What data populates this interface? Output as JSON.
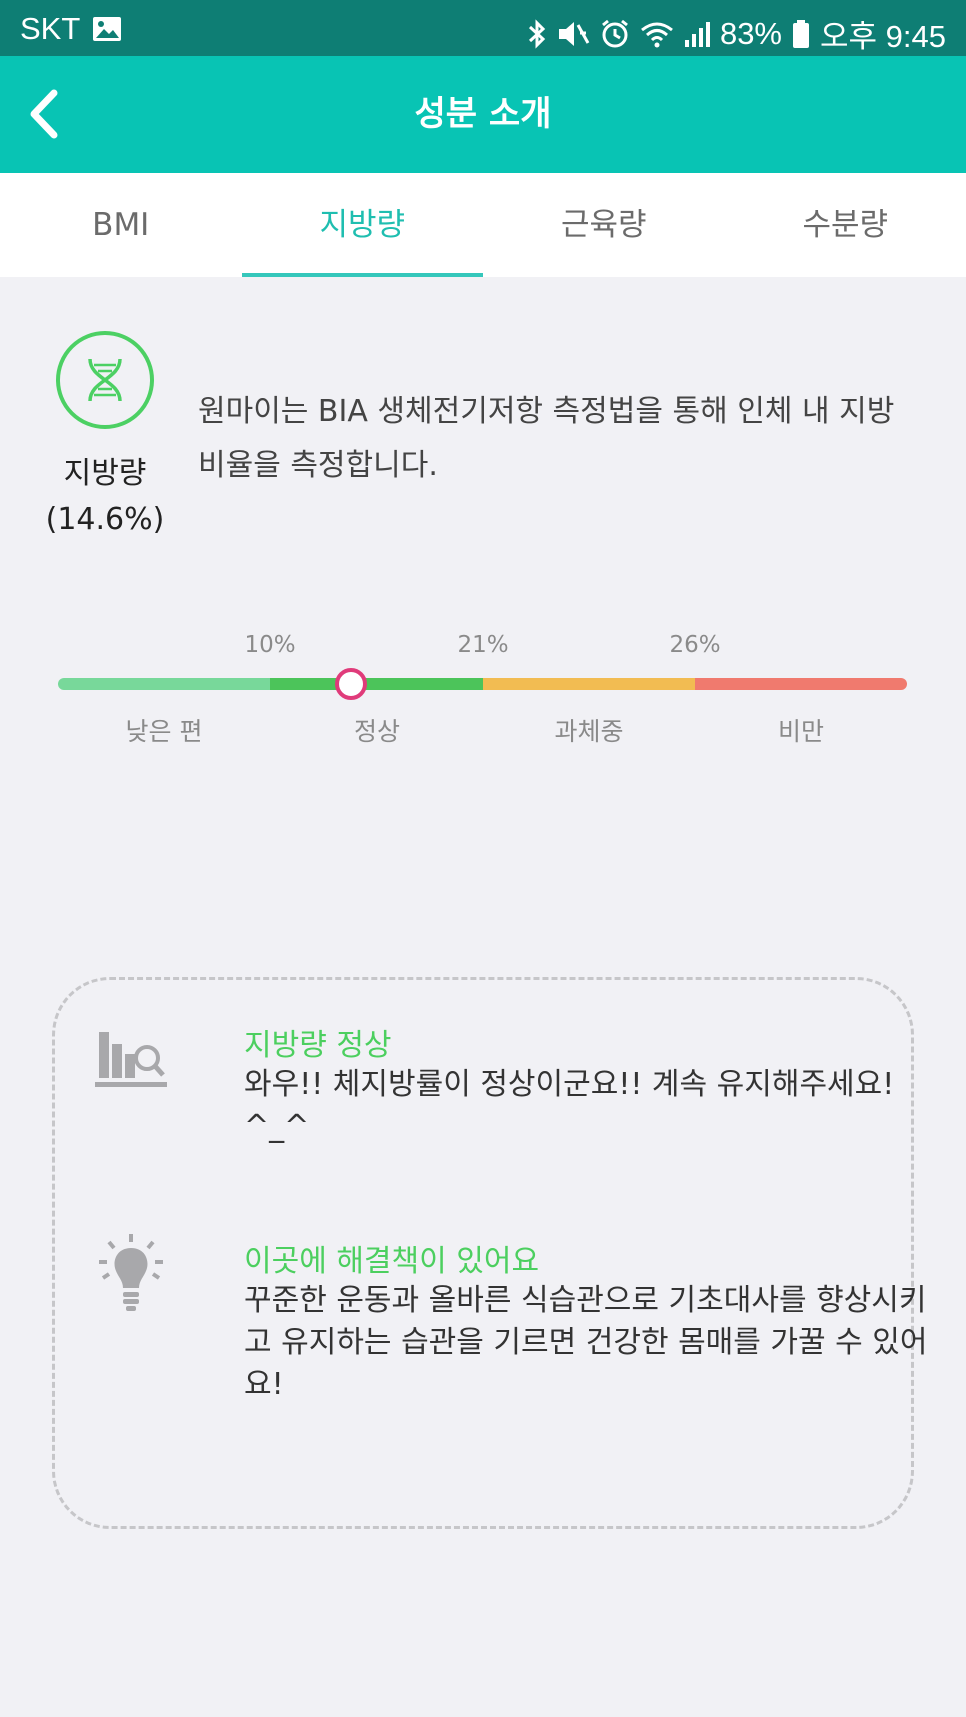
{
  "status_bar": {
    "carrier": "SKT",
    "battery": "83%",
    "time": "오후 9:45",
    "icons": [
      "image-icon",
      "bluetooth-icon",
      "mute-icon",
      "alarm-icon",
      "wifi-icon",
      "signal-icon",
      "battery-icon"
    ]
  },
  "header": {
    "title": "성분 소개",
    "back_icon": "back-arrow-icon"
  },
  "tabs": [
    {
      "label": "BMI",
      "active": false
    },
    {
      "label": "지방량",
      "active": true
    },
    {
      "label": "근육량",
      "active": false
    },
    {
      "label": "수분량",
      "active": false
    }
  ],
  "summary": {
    "icon": "dna-icon",
    "name": "지방량",
    "value": "(14.6%)",
    "description": "원마이는 BIA 생체전기저항 측정법을 통해 인체 내 지방 비율을 측정합니다."
  },
  "scale": {
    "ticks": [
      "10%",
      "21%",
      "26%"
    ],
    "categories": [
      "낮은 편",
      "정상",
      "과체중",
      "비만"
    ],
    "colors": [
      "#78d89a",
      "#4cc45a",
      "#f2bc52",
      "#f07a6e"
    ],
    "marker_color": "#e03b7a",
    "marker_position": 0.345
  },
  "info": {
    "status": {
      "icon": "chart-search-icon",
      "title": "지방량 정상",
      "text": "와우!! 체지방률이 정상이군요!! 계속 유지해주세요! ^_^"
    },
    "tip": {
      "icon": "lightbulb-icon",
      "title": "이곳에 해결책이 있어요",
      "text": "꾸준한 운동과 올바른 식습관으로 기초대사를 향상시키고 유지하는 습관을 기르면 건강한 몸매를 가꿀 수 있어요!"
    }
  }
}
